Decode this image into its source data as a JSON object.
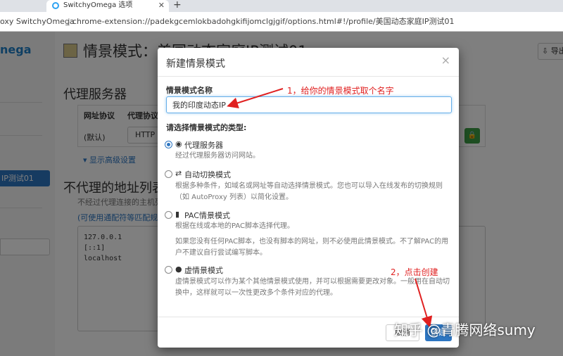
{
  "browser": {
    "tab_title": "SwitchyOmega 选项",
    "site_name": "oxy SwitchyOmega",
    "url": "chrome-extension://padekgcemlokbadohgkifijomclgjgif/options.html#!/profile/美国动态家庭IP测试01"
  },
  "background_page": {
    "brand": "nega",
    "title": "情景模式：美国动态家庭IP测试01",
    "export_label": "导出",
    "proxy_section": "代理服务器",
    "table_headers": [
      "网址协议",
      "代理协议"
    ],
    "table_default": "(默认)",
    "protocol_value": "HTTP",
    "advanced_link": "显示高级设置",
    "bypass_section": "不代理的地址列表",
    "bypass_desc": "不经过代理连接的主机列",
    "bypass_hint": "(可使用通配符等匹配规则",
    "bypass_entries": [
      "127.0.0.1",
      "[::1]",
      "localhost"
    ],
    "sidebar_active": "IP测试01"
  },
  "modal": {
    "title": "新建情景模式",
    "close": "×",
    "name_label": "情景模式名称",
    "name_value": "我的印度动态IP",
    "type_label": "请选择情景模式的类型:",
    "options": [
      {
        "icon": "globe-icon",
        "title": "代理服务器",
        "selected": true,
        "desc": [
          "经过代理服务器访问网站。"
        ]
      },
      {
        "icon": "switch-icon",
        "title": "自动切换模式",
        "selected": false,
        "desc": [
          "根据多种条件，如域名或网址等自动选择情景模式。您也可以导入在线发布的切换规则",
          "（如 AutoProxy 列表）以简化设置。"
        ]
      },
      {
        "icon": "file-icon",
        "title": "PAC情景模式",
        "selected": false,
        "desc": [
          "根据在线或本地的PAC脚本选择代理。",
          "如果您没有任何PAC脚本，也没有脚本的网址，则不必使用此情景模式。不了解PAC的用",
          "户不建议自行尝试编写脚本。"
        ]
      },
      {
        "icon": "ghost-icon",
        "title": "虚情景模式",
        "selected": false,
        "desc": [
          "虚情景模式可以作为某个其他情景模式使用，并可以根据需要更改对象。一般用在自动切",
          "换中，这样就可以一次性更改多个条件对应的代理。"
        ]
      }
    ],
    "cancel_label": "取消",
    "create_label": "创建"
  },
  "annotations": {
    "step1": "1，给你的情景模式取个名字",
    "step2": "2，点击创建",
    "watermark": "知乎 @青腾网络sumy"
  },
  "colors": {
    "accent": "#2d76c2",
    "annotation": "#e02020"
  }
}
